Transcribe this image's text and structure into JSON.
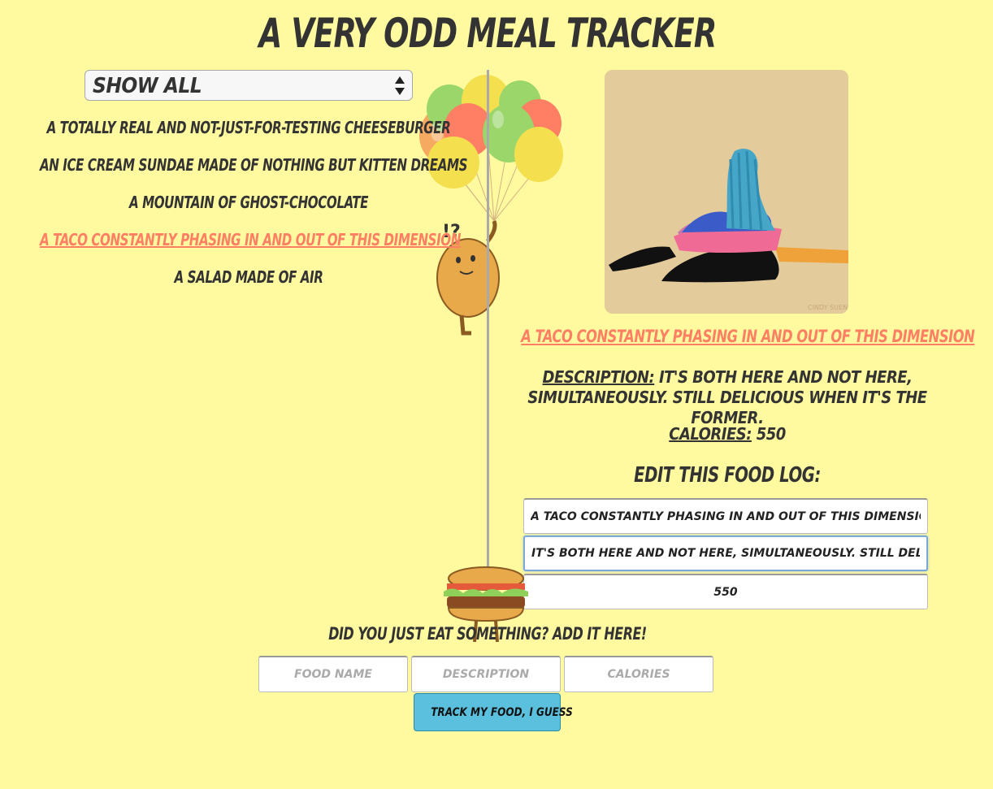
{
  "header": {
    "title": "A Very Odd Meal Tracker"
  },
  "filter": {
    "selected": "Show All"
  },
  "food_list": [
    {
      "name": "A totally real and not-just-for-testing cheeseburger",
      "selected": false
    },
    {
      "name": "An ice cream sundae made of nothing but kitten dreams",
      "selected": false
    },
    {
      "name": "A mountain of ghost-chocolate",
      "selected": false
    },
    {
      "name": "A taco constantly phasing in and out of this dimension",
      "selected": true
    },
    {
      "name": "A salad made of air",
      "selected": false
    }
  ],
  "detail": {
    "name": "A taco constantly phasing in and out of this dimension",
    "description_label": "Description:",
    "description": "It's both here and not here, simultaneously. Still delicious when it's the former.",
    "calories_label": "Calories:",
    "calories": "550",
    "image_watermark": "CINDY SUEN"
  },
  "edit_form": {
    "heading": "Edit this food log:",
    "name_value": "A taco constantly phasing in and out of this dimension",
    "description_value": "It's both here and not here, simultaneously. Still delicious when it's the former.",
    "calories_value": "550"
  },
  "add_form": {
    "heading": "Did you just eat something? Add it here!",
    "name_placeholder": "Food name",
    "description_placeholder": "Description",
    "calories_placeholder": "Calories",
    "submit_label": "Track my food, I guess"
  },
  "colors": {
    "background": "#fffa9f",
    "accent": "#ff7f64",
    "button": "#5bc0de",
    "text": "#333333"
  }
}
